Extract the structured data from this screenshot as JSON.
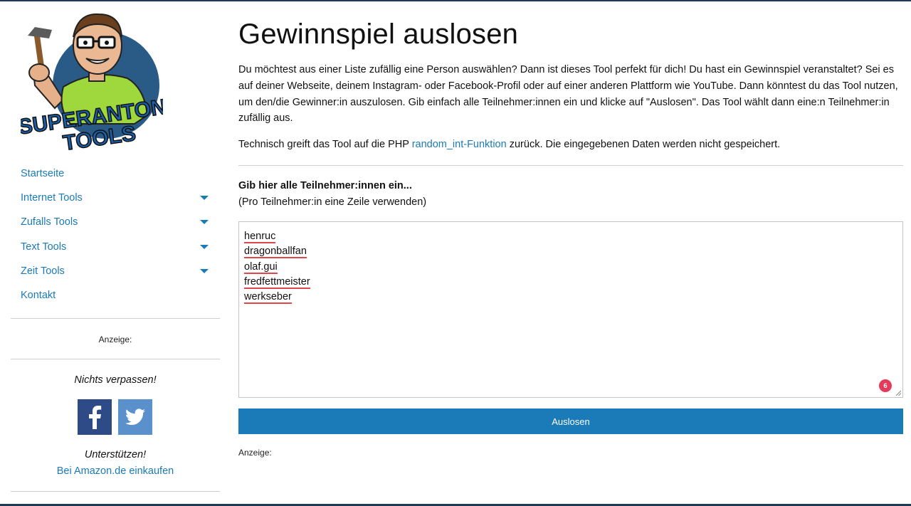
{
  "sidebar": {
    "nav": [
      {
        "label": "Startseite",
        "has_submenu": false
      },
      {
        "label": "Internet Tools",
        "has_submenu": true
      },
      {
        "label": "Zufalls Tools",
        "has_submenu": true
      },
      {
        "label": "Text Tools",
        "has_submenu": true
      },
      {
        "label": "Zeit Tools",
        "has_submenu": true
      },
      {
        "label": "Kontakt",
        "has_submenu": false
      }
    ],
    "ad_label": "Anzeige:",
    "follow_heading": "Nichts verpassen!",
    "social": [
      {
        "icon": "facebook-icon",
        "color": "#2e4b88"
      },
      {
        "icon": "twitter-icon",
        "color": "#5a91cc"
      }
    ],
    "support_heading": "Unterstützen!",
    "amazon_link": "Bei Amazon.de einkaufen"
  },
  "main": {
    "title": "Gewinnspiel auslosen",
    "intro": "Du möchtest aus einer Liste zufällig eine Person auswählen? Dann ist dieses Tool perfekt für dich! Du hast ein Gewinnspiel veranstaltet? Sei es auf deiner Webseite, deinem Instagram- oder Facebook-Profil oder auf einer anderen Plattform wie YouTube. Dann könntest du das Tool nutzen, um den/die Gewinner:in auszulosen. Gib einfach alle Teilnehmer:innen ein und klicke auf \"Auslosen\". Das Tool wählt dann eine:n Teilnehmer:in zufällig aus.",
    "tech_before": "Technisch greift das Tool auf die PHP ",
    "tech_link": "random_int-Funktion",
    "tech_after": " zurück. Die eingegebenen Daten werden nicht gespeichert.",
    "prompt_bold": "Gib hier alle Teilnehmer:innen ein...",
    "prompt_hint": "(Pro Teilnehmer:in eine Zeile verwenden)",
    "participants": [
      "henruc",
      "dragonballfan",
      "olaf.gui",
      "fredfettmeister",
      "werkseber"
    ],
    "spellcheck_badge": "6",
    "button_label": "Auslosen",
    "ad_label": "Anzeige:"
  },
  "colors": {
    "accent": "#1b7ab8",
    "border_dark": "#1f3a55",
    "badge": "#e53b5a",
    "spell_underline": "#e0474c"
  },
  "logo": {
    "text_line1": "SUPERANTON",
    "text_line2": "TOOLS",
    "alt_icon": "superanton-mascot-logo"
  }
}
